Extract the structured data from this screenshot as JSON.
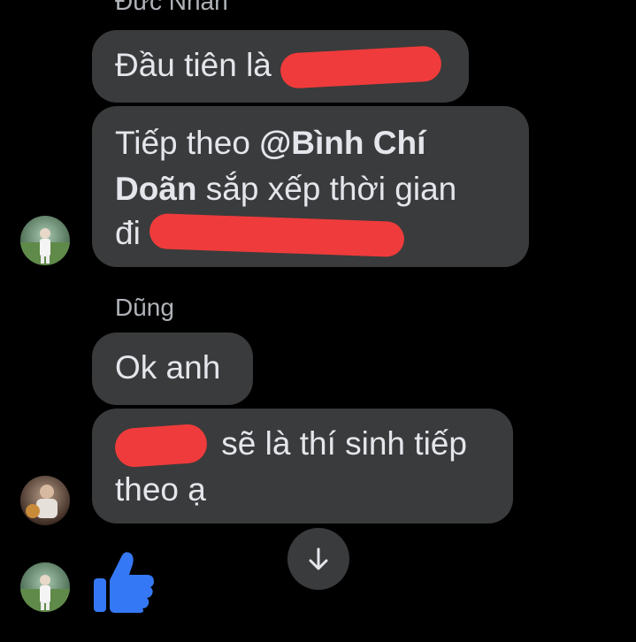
{
  "messages": [
    {
      "sender": "Đức Nhân",
      "text": "Đầu tiên là"
    },
    {
      "mention": "@Bình Chí Doãn",
      "prefix": "Tiếp theo",
      "text_after": "sắp xếp thời gian",
      "line3": "đi"
    },
    {
      "sender": "Dũng",
      "text": "Ok anh"
    },
    {
      "text": "sẽ là thí sinh tiếp",
      "line2": "theo ạ"
    }
  ],
  "icons": {
    "scroll_down": "arrow-down-icon",
    "reaction": "thumbs-up-icon"
  },
  "colors": {
    "background": "#000000",
    "bubble": "#3a3b3c",
    "redaction": "#ef3b3b",
    "like": "#3578f5"
  }
}
